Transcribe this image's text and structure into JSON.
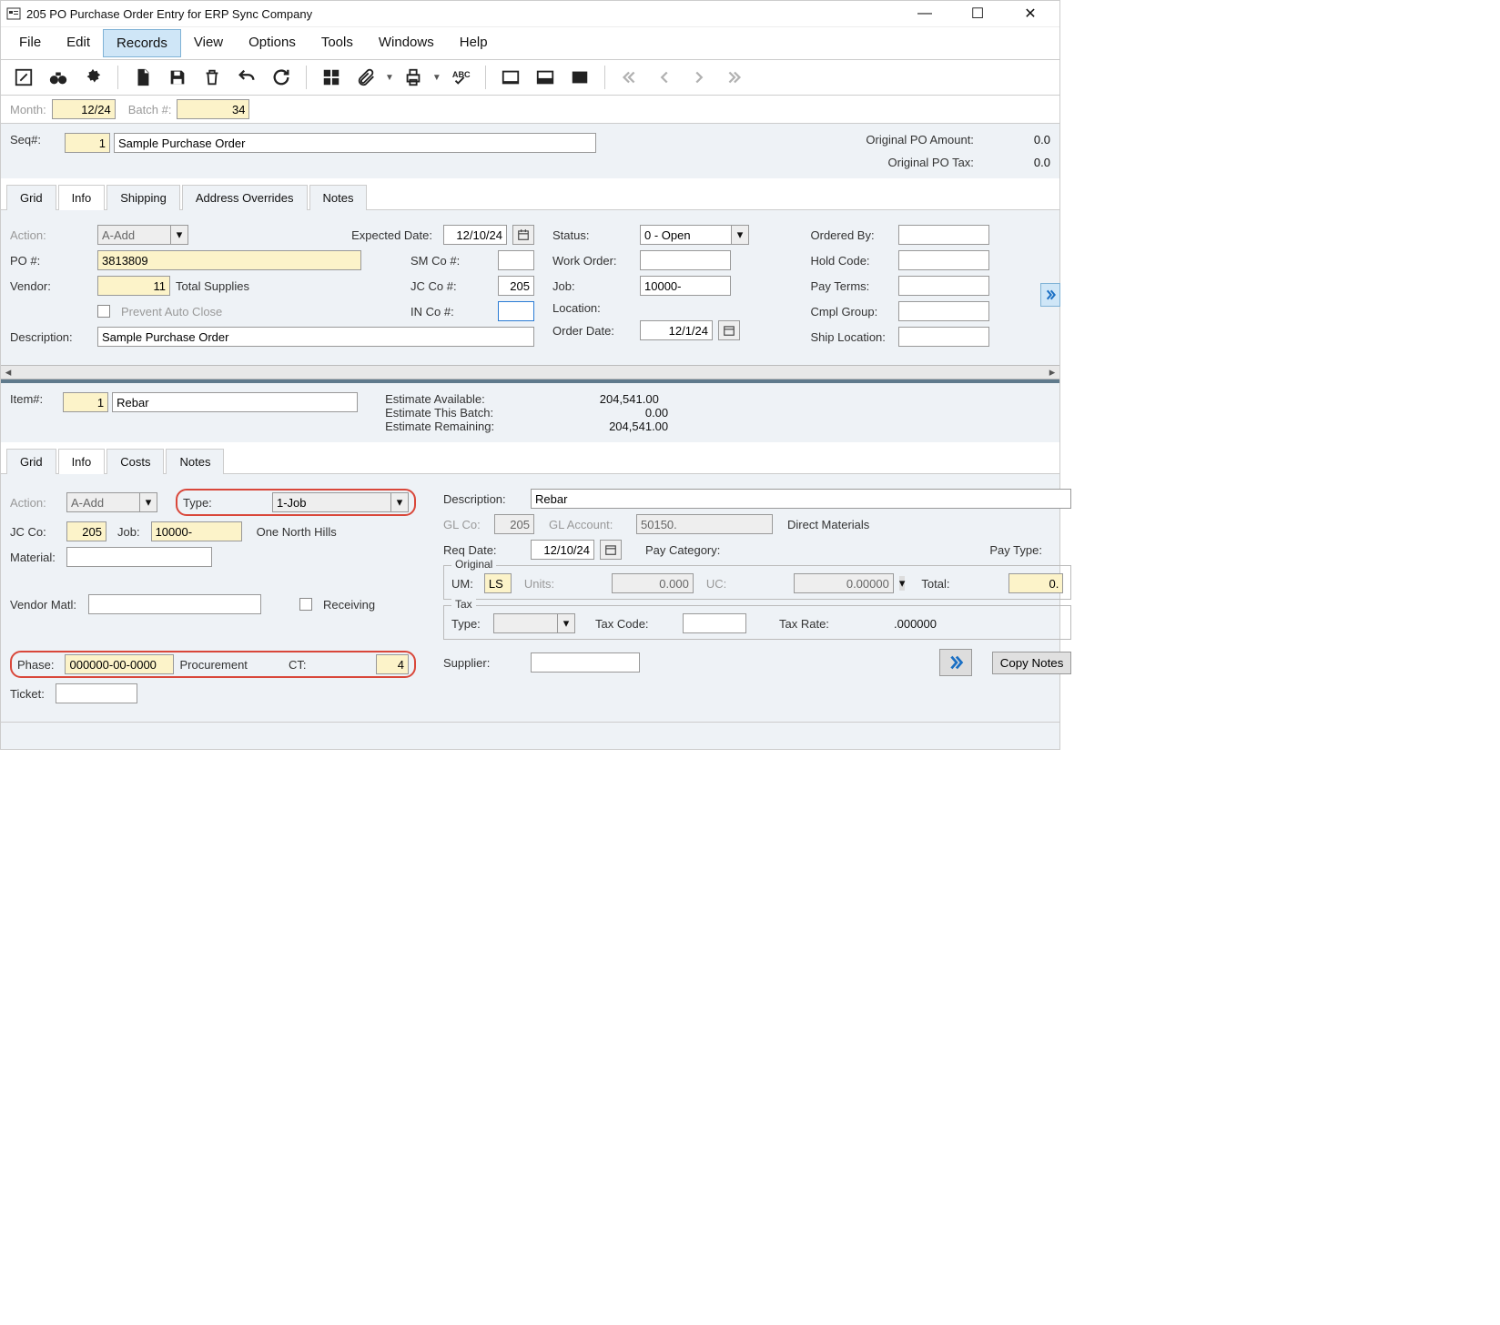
{
  "window": {
    "title": "205 PO Purchase Order Entry for ERP Sync Company"
  },
  "menu": {
    "file": "File",
    "edit": "Edit",
    "records": "Records",
    "view": "View",
    "options": "Options",
    "tools": "Tools",
    "windows": "Windows",
    "help": "Help"
  },
  "batchbar": {
    "month_lbl": "Month:",
    "month": "12/24",
    "batch_lbl": "Batch #:",
    "batch": "34"
  },
  "seqrow": {
    "seq_lbl": "Seq#:",
    "seq": "1",
    "desc": "Sample Purchase Order",
    "orig_amt_lbl": "Original PO Amount:",
    "orig_amt": "0.0",
    "orig_tax_lbl": "Original PO Tax:",
    "orig_tax": "0.0"
  },
  "tabs1": {
    "grid": "Grid",
    "info": "Info",
    "shipping": "Shipping",
    "addr": "Address Overrides",
    "notes": "Notes"
  },
  "info": {
    "action_lbl": "Action:",
    "action_val": "A-Add",
    "expected_lbl": "Expected Date:",
    "expected": "12/10/24",
    "status_lbl": "Status:",
    "status_val": "0 - Open",
    "orderedby_lbl": "Ordered By:",
    "orderedby": "",
    "po_lbl": "PO #:",
    "po": "3813809",
    "smco_lbl": "SM Co #:",
    "smco": "",
    "workorder_lbl": "Work Order:",
    "workorder": "",
    "hold_lbl": "Hold Code:",
    "hold": "",
    "vendor_lbl": "Vendor:",
    "vendor": "11",
    "vendor_name": "Total Supplies",
    "jcco_lbl": "JC Co #:",
    "jcco": "205",
    "job_lbl": "Job:",
    "job": "10000-",
    "payterms_lbl": "Pay Terms:",
    "payterms": "",
    "prevent_lbl": "Prevent Auto Close",
    "inco_lbl": "IN Co #:",
    "inco": "",
    "location_lbl": "Location:",
    "location": "",
    "cmpl_lbl": "Cmpl Group:",
    "cmpl": "",
    "desc_lbl": "Description:",
    "desc": "Sample Purchase Order",
    "orderdate_lbl": "Order Date:",
    "orderdate": "12/1/24",
    "shiploc_lbl": "Ship Location:",
    "shiploc": ""
  },
  "itemrow": {
    "item_lbl": "Item#:",
    "item": "1",
    "item_desc": "Rebar",
    "estavail_lbl": "Estimate Available:",
    "estavail": "204,541.00",
    "estbatch_lbl": "Estimate This Batch:",
    "estbatch": "0.00",
    "estrem_lbl": "Estimate Remaining:",
    "estrem": "204,541.00"
  },
  "tabs2": {
    "grid": "Grid",
    "info": "Info",
    "costs": "Costs",
    "notes": "Notes"
  },
  "detail": {
    "action_lbl": "Action:",
    "action_val": "A-Add",
    "type_lbl": "Type:",
    "type_val": "1-Job",
    "jcco_lbl": "JC Co:",
    "jcco": "205",
    "job_lbl": "Job:",
    "job": "10000-",
    "job_name": "One North Hills",
    "material_lbl": "Material:",
    "material": "",
    "vendmatl_lbl": "Vendor Matl:",
    "vendmatl": "",
    "receiving_lbl": "Receiving",
    "phase_lbl": "Phase:",
    "phase": "000000-00-0000",
    "phase_name": "Procurement",
    "ct_lbl": "CT:",
    "ct": "4",
    "ticket_lbl": "Ticket:",
    "ticket": "",
    "desc_lbl": "Description:",
    "desc": "Rebar",
    "glco_lbl": "GL Co:",
    "glco": "205",
    "glacct_lbl": "GL Account:",
    "glacct": "50150.",
    "glacct_name": "Direct Materials",
    "reqdate_lbl": "Req Date:",
    "reqdate": "12/10/24",
    "paycat_lbl": "Pay Category:",
    "paytype_lbl": "Pay Type:",
    "orig_legend": "Original",
    "um_lbl": "UM:",
    "um": "LS",
    "units_lbl": "Units:",
    "units": "0.000",
    "uc_lbl": "UC:",
    "uc": "0.00000",
    "total_lbl": "Total:",
    "total": "0.",
    "tax_legend": "Tax",
    "taxtype_lbl": "Type:",
    "taxcode_lbl": "Tax Code:",
    "taxrate_lbl": "Tax Rate:",
    "taxrate": ".000000",
    "supplier_lbl": "Supplier:",
    "copy_btn": "Copy Notes"
  }
}
